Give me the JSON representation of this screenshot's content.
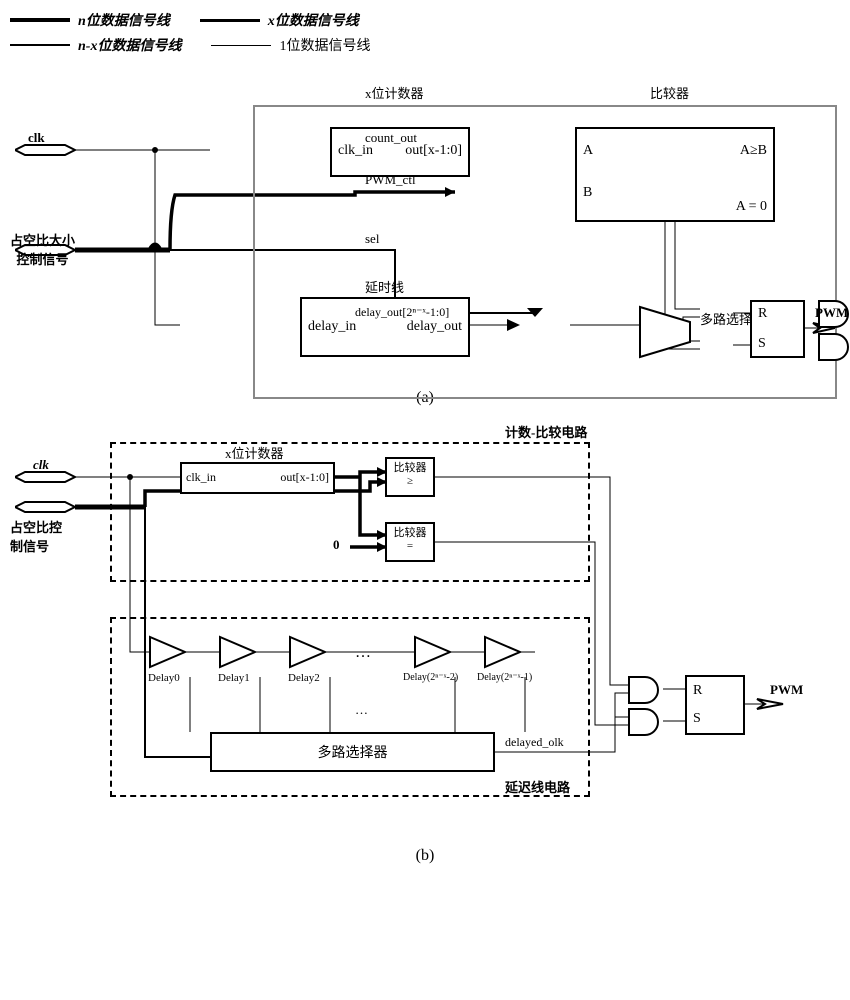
{
  "legend": {
    "n_bit": "n位数据信号线",
    "x_bit": "x位数据信号线",
    "nx_bit": "n-x位数据信号线",
    "one_bit": "1位数据信号线"
  },
  "a": {
    "clk": "clk",
    "duty": "占空比大小\n控制信号",
    "counter": {
      "title": "x位计数器",
      "clk_in": "clk_in",
      "out": "out[x-1:0]"
    },
    "delay": {
      "title": "延时线",
      "in": "delay_in",
      "out": "delay_out"
    },
    "comp": {
      "title": "比较器",
      "A": "A",
      "B": "B",
      "ageb": "A≥B",
      "aeq0": "A = 0"
    },
    "count_out": "count_out",
    "pwm_ctl": "PWM_ctl",
    "sel": "sel",
    "delay_out": "delay_out[2ⁿ⁻ˣ-1:0]",
    "mux": "多路选择器",
    "R": "R",
    "S": "S",
    "pwm": "PWM"
  },
  "b": {
    "clk": "clk",
    "duty": "占空比控\n制信号",
    "cnt_cmp": "计数-比较电路",
    "counter": {
      "title": "x位计数器",
      "clk_in": "clk_in",
      "out": "out[x-1:0]"
    },
    "cmp1": "比较器\n≥",
    "cmp2": "比较器\n=",
    "zero": "0",
    "delay_line": "延迟线电路",
    "delays": [
      "Delay0",
      "Delay1",
      "Delay2",
      "Delay(2ⁿ⁻ˣ-2)",
      "Delay(2ⁿ⁻ˣ-1)"
    ],
    "mux": "多路选择器",
    "delayed_clk": "delayed_olk",
    "R": "R",
    "S": "S",
    "pwm": "PWM"
  },
  "cap_a": "(a)",
  "cap_b": "(b)"
}
